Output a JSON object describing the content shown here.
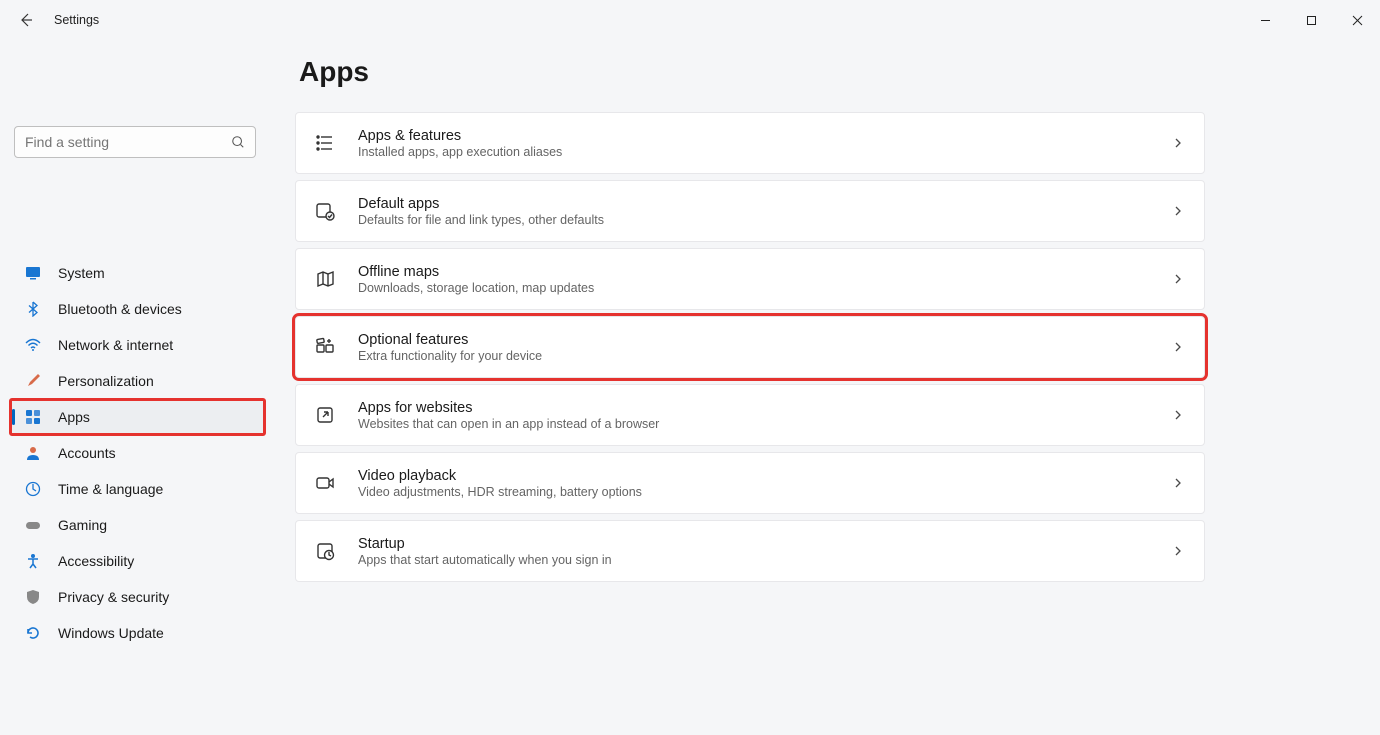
{
  "window": {
    "title": "Settings"
  },
  "search": {
    "placeholder": "Find a setting"
  },
  "sidebar": {
    "items": [
      {
        "label": "System"
      },
      {
        "label": "Bluetooth & devices"
      },
      {
        "label": "Network & internet"
      },
      {
        "label": "Personalization"
      },
      {
        "label": "Apps"
      },
      {
        "label": "Accounts"
      },
      {
        "label": "Time & language"
      },
      {
        "label": "Gaming"
      },
      {
        "label": "Accessibility"
      },
      {
        "label": "Privacy & security"
      },
      {
        "label": "Windows Update"
      }
    ]
  },
  "page": {
    "title": "Apps"
  },
  "cards": [
    {
      "title": "Apps & features",
      "sub": "Installed apps, app execution aliases"
    },
    {
      "title": "Default apps",
      "sub": "Defaults for file and link types, other defaults"
    },
    {
      "title": "Offline maps",
      "sub": "Downloads, storage location, map updates"
    },
    {
      "title": "Optional features",
      "sub": "Extra functionality for your device"
    },
    {
      "title": "Apps for websites",
      "sub": "Websites that can open in an app instead of a browser"
    },
    {
      "title": "Video playback",
      "sub": "Video adjustments, HDR streaming, battery options"
    },
    {
      "title": "Startup",
      "sub": "Apps that start automatically when you sign in"
    }
  ]
}
